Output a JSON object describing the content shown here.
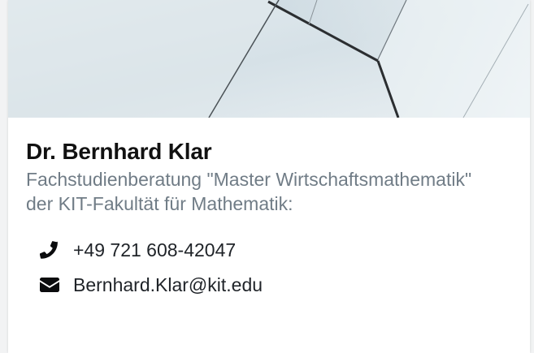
{
  "person": {
    "name": "Dr. Bernhard Klar",
    "role": "Fachstudienberatung \"Master Wirtschaftsmathematik\" der KIT-Fakultät für Mathematik:"
  },
  "contact": {
    "phone": {
      "icon": "phone-icon",
      "value": "+49 721 608-42047"
    },
    "email": {
      "icon": "envelope-icon",
      "value": "Bernhard.Klar@kit.edu"
    }
  },
  "colors": {
    "name_text": "#111111",
    "role_text": "#707c86",
    "contact_text": "#1f2328",
    "icon": "#0b0c0e",
    "hero_sky": "#d9e4ea"
  }
}
